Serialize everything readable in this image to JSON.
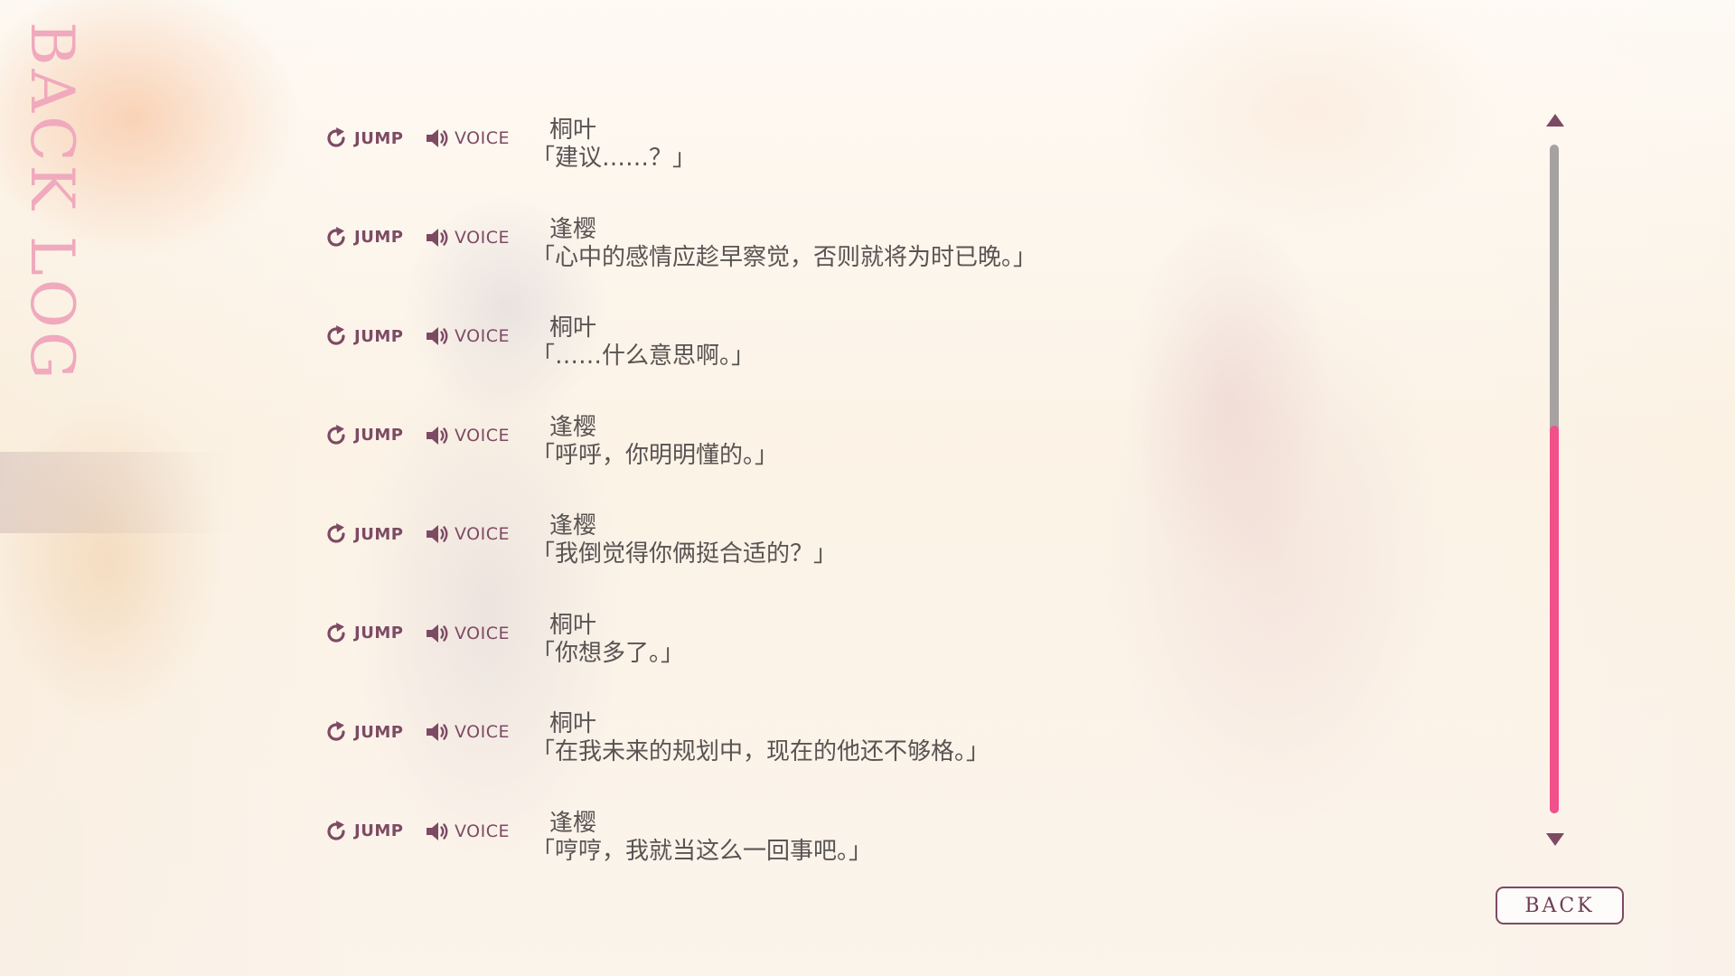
{
  "screen": {
    "title": "BACK LOG",
    "jump_label": "JUMP",
    "voice_label": "VOICE",
    "back_label": "BACK"
  },
  "colors": {
    "title": "#f0a9bd",
    "accent": "#7d4a63",
    "scroll_thumb": "#f2508a",
    "scroll_track": "#a6a2a2",
    "text": "#5a5353"
  },
  "icons": {
    "jump": "jump-arrow-icon",
    "voice": "speaker-icon",
    "scroll_up": "triangle-up-icon",
    "scroll_down": "triangle-down-icon"
  },
  "scrollbar": {
    "thumb_start_fraction": 0.42,
    "thumb_end_fraction": 1.0
  },
  "entries": [
    {
      "speaker": "桐叶",
      "text": "「建议……？」"
    },
    {
      "speaker": "逢樱",
      "text": "「心中的感情应趁早察觉，否则就将为时已晚。」"
    },
    {
      "speaker": "桐叶",
      "text": "「……什么意思啊。」"
    },
    {
      "speaker": "逢樱",
      "text": "「呼呼，你明明懂的。」"
    },
    {
      "speaker": "逢樱",
      "text": "「我倒觉得你俩挺合适的？」"
    },
    {
      "speaker": "桐叶",
      "text": "「你想多了。」"
    },
    {
      "speaker": "桐叶",
      "text": "「在我未来的规划中，现在的他还不够格。」"
    },
    {
      "speaker": "逢樱",
      "text": "「哼哼，我就当这么一回事吧。」"
    }
  ]
}
